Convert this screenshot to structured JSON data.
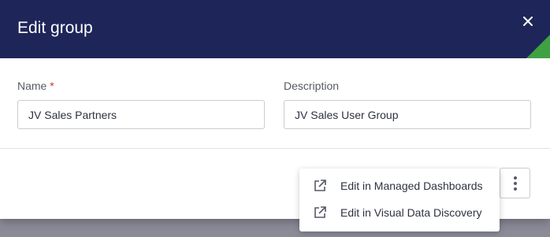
{
  "dialog": {
    "title": "Edit group",
    "close_icon": "close-icon"
  },
  "form": {
    "name": {
      "label": "Name",
      "required_mark": "*",
      "value": "JV Sales Partners"
    },
    "description": {
      "label": "Description",
      "value": "JV Sales User Group"
    }
  },
  "actions": {
    "more_icon": "more-vertical-icon",
    "menu_items": [
      {
        "label": "Edit in Managed Dashboards",
        "icon": "external-link-icon"
      },
      {
        "label": "Edit in Visual Data Discovery",
        "icon": "external-link-icon"
      }
    ]
  },
  "colors": {
    "header_bg": "#1e2559",
    "accent": "#3fa142",
    "required": "#d32f2f"
  }
}
